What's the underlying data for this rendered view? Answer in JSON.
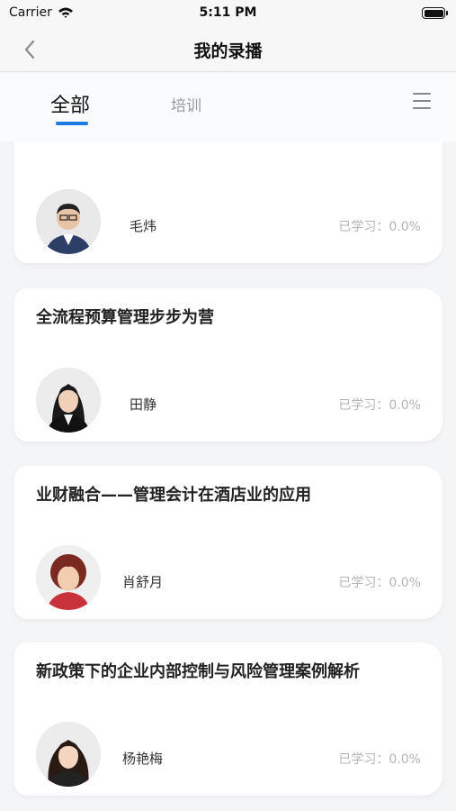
{
  "status_bar": {
    "carrier": "Carrier",
    "time": "5:11 PM"
  },
  "nav": {
    "title": "我的录播"
  },
  "tabs": [
    {
      "label": "全部",
      "active": true
    },
    {
      "label": "培训",
      "active": false
    }
  ],
  "colors": {
    "accent": "#1d7ae6",
    "progress_text": "#b4b4b4"
  },
  "courses": [
    {
      "title": "",
      "teacher": "毛炜",
      "progress_label": "已学习：0.0%"
    },
    {
      "title": "全流程预算管理步步为营",
      "teacher": "田静",
      "progress_label": "已学习：0.0%"
    },
    {
      "title": "业财融合——管理会计在酒店业的应用",
      "teacher": "肖舒月",
      "progress_label": "已学习：0.0%"
    },
    {
      "title": "新政策下的企业内部控制与风险管理案例解析",
      "teacher": "杨艳梅",
      "progress_label": "已学习：0.0%"
    }
  ]
}
